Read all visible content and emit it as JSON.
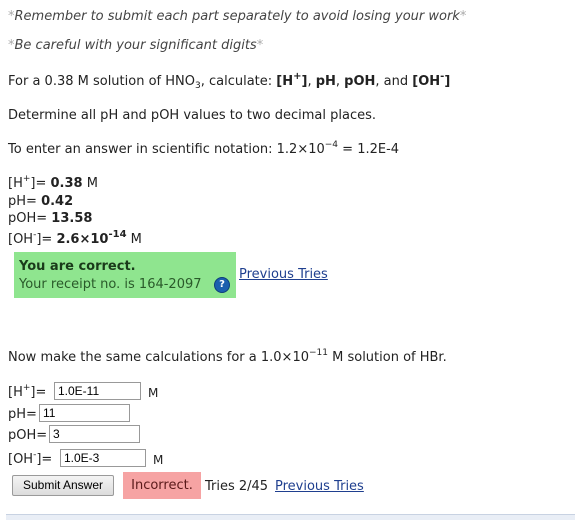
{
  "notes": {
    "submit_separately": "Remember to submit each part separately to avoid losing your work",
    "sig_digits": "Be careful with your significant digits",
    "star": "*"
  },
  "problem1": {
    "prompt_pre": "For a 0.38 M solution of HNO",
    "prompt_sub": "3",
    "prompt_mid": ", calculate: ",
    "targets": {
      "h_label": "[H",
      "h_sup": "+",
      "h_close": "]",
      "sep1": ", ",
      "ph": "pH",
      "sep2": ", ",
      "poh": "pOH",
      "sep3": ", and ",
      "oh_label": "[OH",
      "oh_sup": "-",
      "oh_close": "]"
    },
    "decimals_note": "Determine all pH and pOH values to two decimal places.",
    "sci_note_pre": "To enter an answer in scientific notation: 1.2×10",
    "sci_note_exp": "−4",
    "sci_note_post": " = 1.2E-4",
    "answers": {
      "h_label": "[H",
      "h_sup": "+",
      "h_eq": "]= ",
      "h_value": "0.38",
      "h_unit": " M",
      "ph_label": "pH= ",
      "ph_value": "0.42",
      "poh_label": "pOH= ",
      "poh_value": "13.58",
      "oh_label": "[OH",
      "oh_sup": "-",
      "oh_eq": "]= ",
      "oh_mantissa": "2.6×10",
      "oh_exp": "-14",
      "oh_unit": " M"
    },
    "feedback": {
      "correct": "You are correct.",
      "receipt": "Your receipt no. is 164-2097",
      "help_icon": "?"
    },
    "previous_tries": "Previous Tries"
  },
  "problem2": {
    "prompt_pre": "Now make the same calculations for a 1.0×10",
    "prompt_exp": "−11",
    "prompt_post": " M solution of HBr.",
    "rows": {
      "h_label": "[H",
      "h_sup": "+",
      "h_eq": "]=",
      "h_value": "1.0E-11",
      "h_unit": "M",
      "ph_label": "pH=",
      "ph_value": "11",
      "poh_label": "pOH=",
      "poh_value": "3",
      "oh_label": "[OH",
      "oh_sup": "-",
      "oh_eq": "]=",
      "oh_value": "1.0E-3",
      "oh_unit": "M"
    },
    "submit_label": "Submit Answer",
    "status": "Incorrect.",
    "tries": "Tries 2/45",
    "previous_tries": "Previous Tries"
  }
}
